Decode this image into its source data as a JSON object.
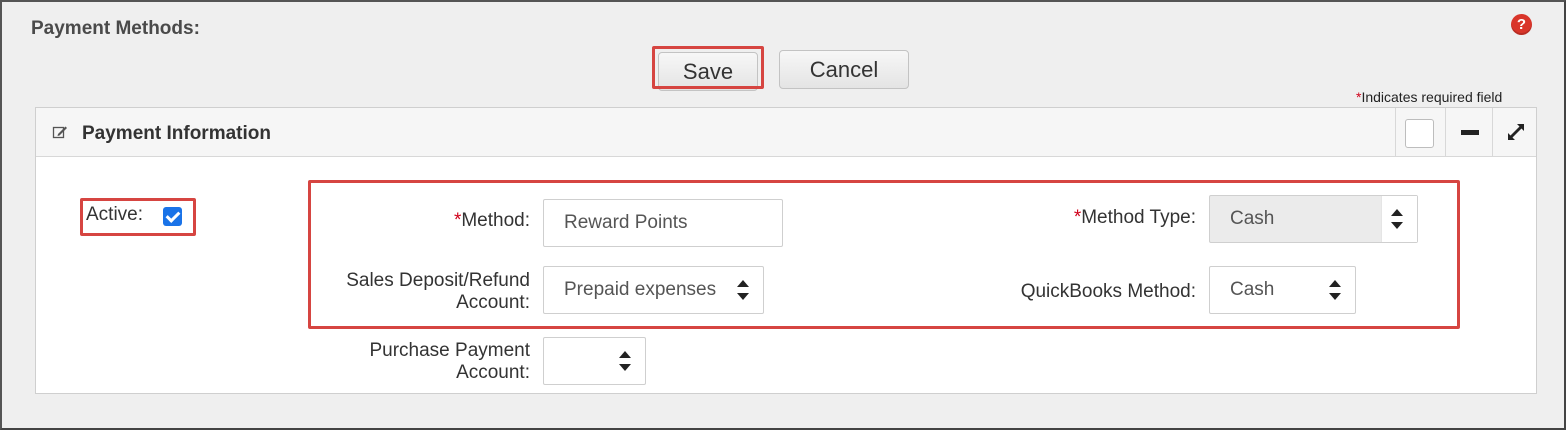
{
  "page": {
    "title": "Payment Methods:"
  },
  "toolbar": {
    "save_label": "Save",
    "cancel_label": "Cancel"
  },
  "required_note": {
    "asterisk": "*",
    "text": "Indicates required field"
  },
  "panel": {
    "title": "Payment Information"
  },
  "form": {
    "active": {
      "label": "Active:",
      "checked": true
    },
    "method": {
      "asterisk": "*",
      "label": "Method:",
      "value": "Reward Points"
    },
    "method_type": {
      "asterisk": "*",
      "label": "Method Type:",
      "value": "Cash"
    },
    "sales_deposit": {
      "label_line1": "Sales Deposit/Refund",
      "label_line2": "Account:",
      "value": "Prepaid expenses"
    },
    "quickbooks_method": {
      "label": "QuickBooks Method:",
      "value": "Cash"
    },
    "purchase_payment": {
      "label_line1": "Purchase Payment",
      "label_line2": "Account:",
      "value": ""
    }
  },
  "colors": {
    "highlight": "#d64541",
    "required": "#d0021b",
    "checkbox": "#1a73e8",
    "help": "#d9352a"
  },
  "icons": {
    "help": "question-circle-icon",
    "edit": "edit-icon",
    "minimize": "minus-icon",
    "expand": "expand-icon"
  },
  "help_glyph": "?"
}
